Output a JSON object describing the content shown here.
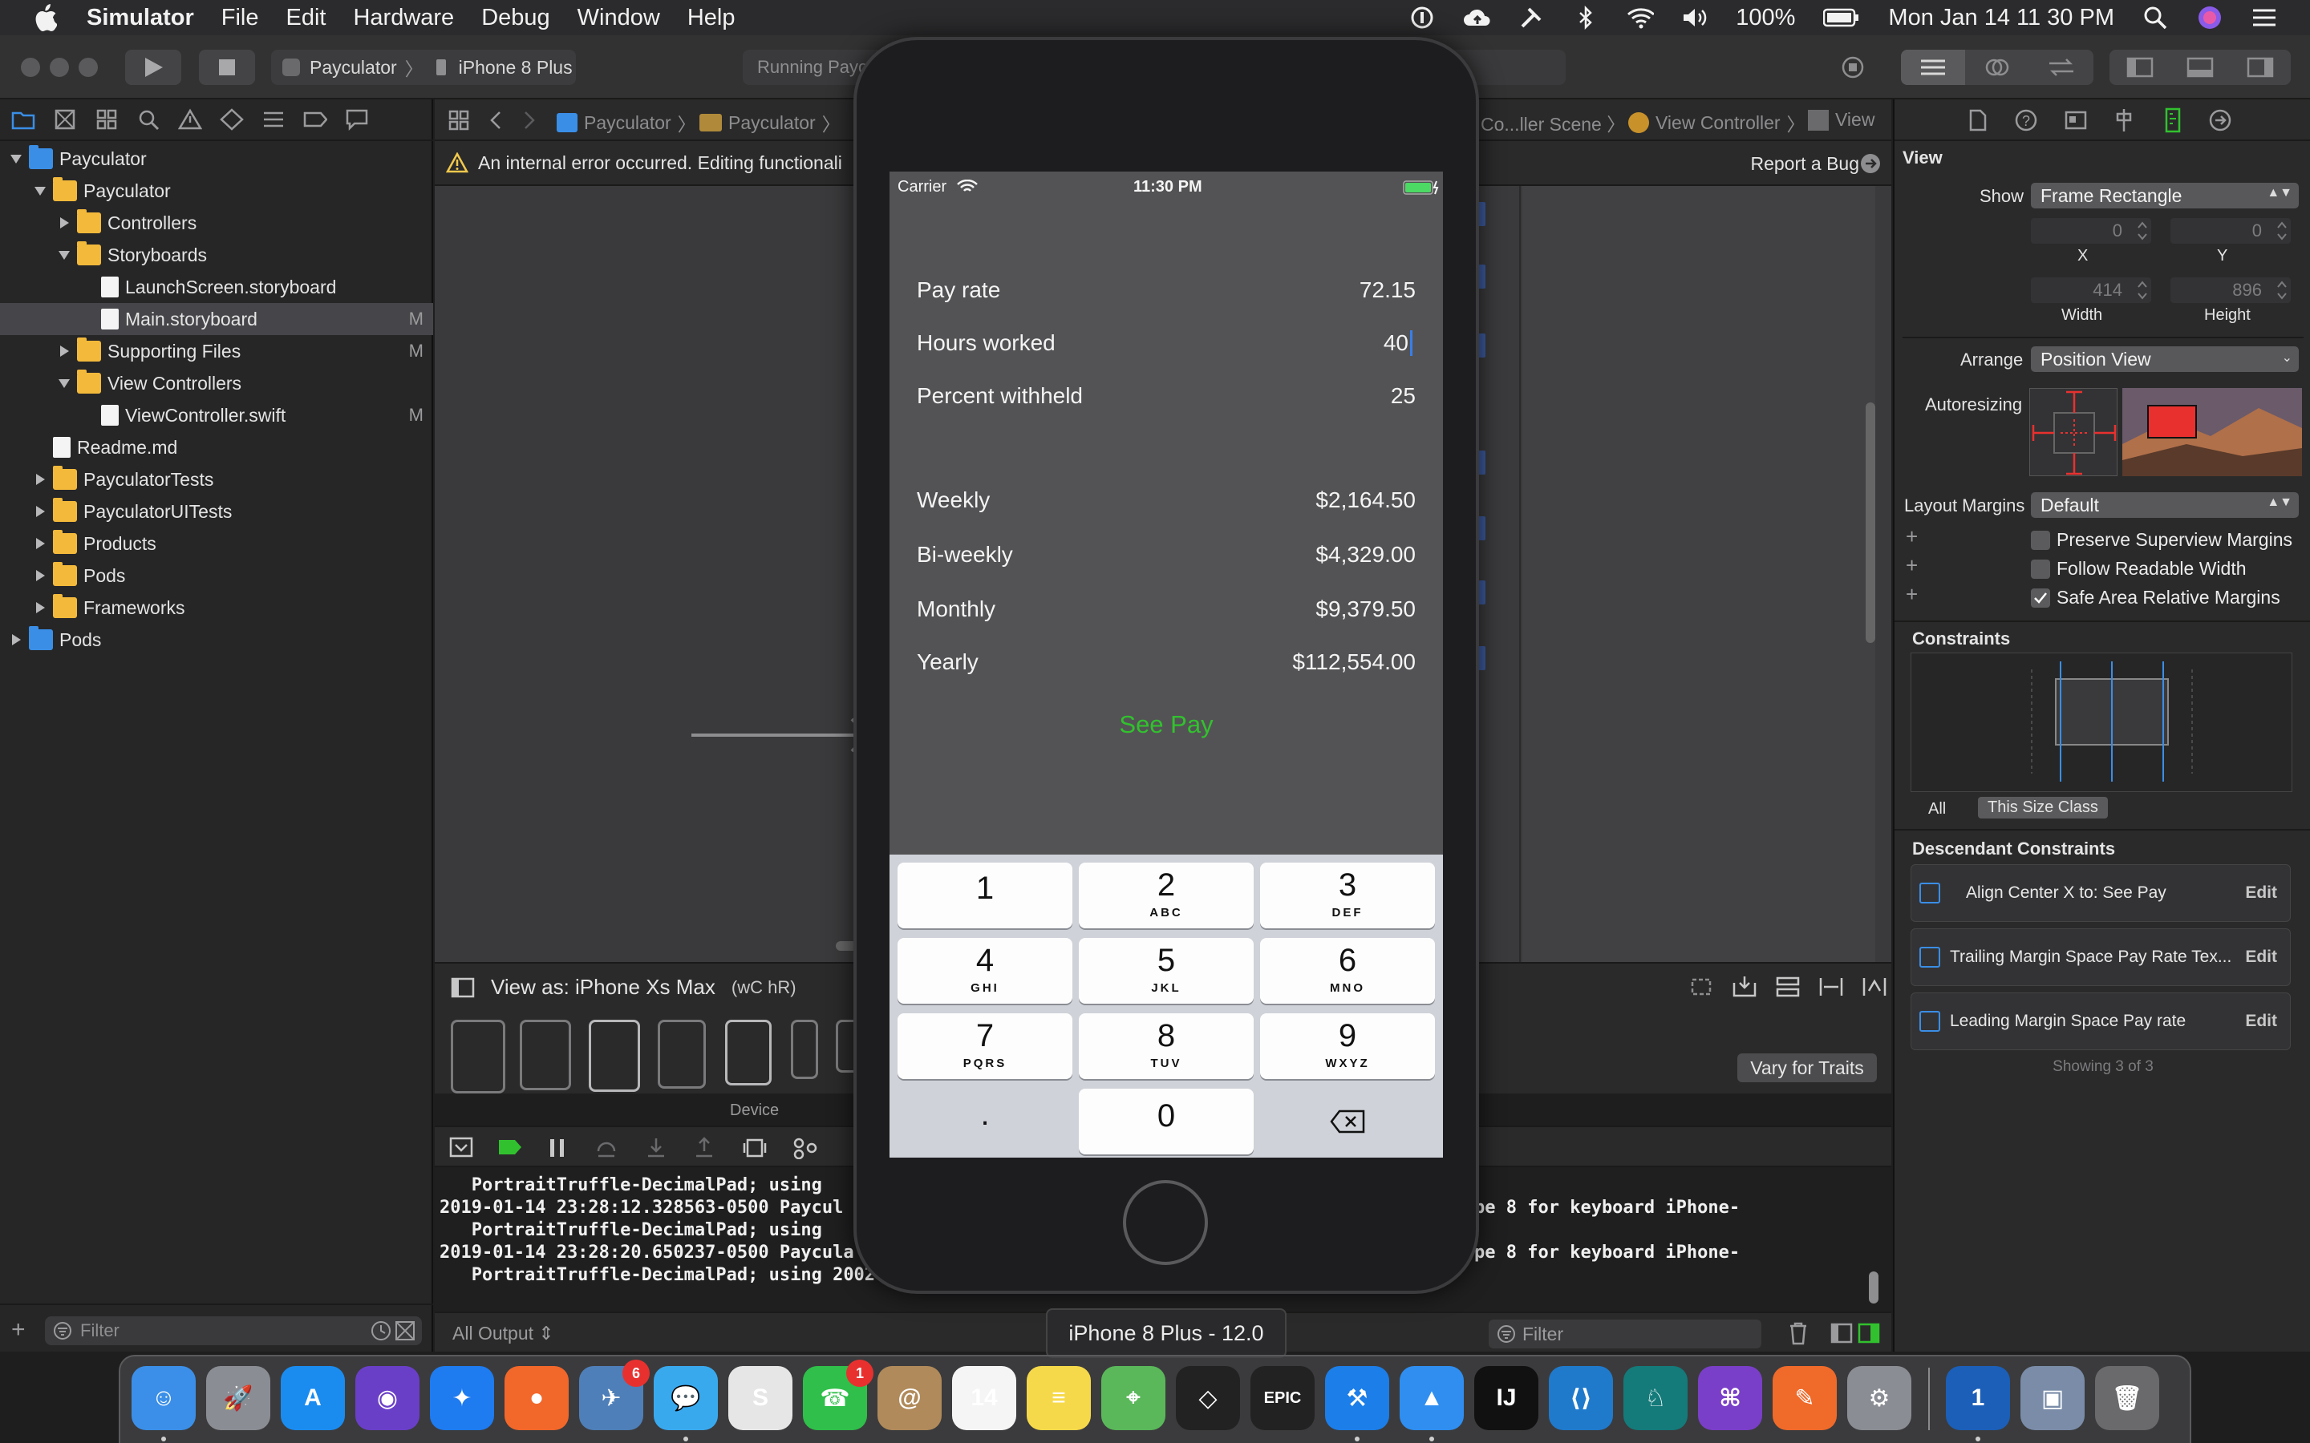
{
  "menubar": {
    "app_name": "Simulator",
    "items": [
      "File",
      "Edit",
      "Hardware",
      "Debug",
      "Window",
      "Help"
    ],
    "battery": "100%",
    "clock": "Mon Jan 14  11 30 PM"
  },
  "toolbar": {
    "scheme_name": "Payculator",
    "destination": "iPhone 8 Plus",
    "activity_text": "Running Payc"
  },
  "navigator": {
    "filter_placeholder": "Filter",
    "tree": [
      {
        "label": "Payculator",
        "type": "project",
        "depth": 0,
        "expanded": true
      },
      {
        "label": "Payculator",
        "type": "folder",
        "depth": 1,
        "expanded": true
      },
      {
        "label": "Controllers",
        "type": "folder",
        "depth": 2,
        "expanded": false
      },
      {
        "label": "Storyboards",
        "type": "folder",
        "depth": 2,
        "expanded": true
      },
      {
        "label": "LaunchScreen.storyboard",
        "type": "file",
        "depth": 3
      },
      {
        "label": "Main.storyboard",
        "type": "file",
        "depth": 3,
        "badge": "M",
        "selected": true
      },
      {
        "label": "Supporting Files",
        "type": "folder",
        "depth": 2,
        "expanded": false,
        "badge": "M"
      },
      {
        "label": "View Controllers",
        "type": "folder",
        "depth": 2,
        "expanded": true
      },
      {
        "label": "ViewController.swift",
        "type": "file",
        "depth": 3,
        "badge": "M"
      },
      {
        "label": "Readme.md",
        "type": "file",
        "depth": 1
      },
      {
        "label": "PayculatorTests",
        "type": "folder",
        "depth": 1,
        "expanded": false
      },
      {
        "label": "PayculatorUITests",
        "type": "folder",
        "depth": 1,
        "expanded": false
      },
      {
        "label": "Products",
        "type": "folder",
        "depth": 1,
        "expanded": false
      },
      {
        "label": "Pods",
        "type": "folder",
        "depth": 1,
        "expanded": false
      },
      {
        "label": "Frameworks",
        "type": "folder",
        "depth": 1,
        "expanded": false
      },
      {
        "label": "Pods",
        "type": "project",
        "depth": 0,
        "expanded": false
      }
    ]
  },
  "editor": {
    "jumpbar": [
      "Payculator",
      "Payculator",
      "Co...ller Scene",
      "View Controller",
      "View"
    ],
    "warning": "An internal error occurred. Editing functionali",
    "report_bug": "Report a Bug",
    "view_as": "View as: iPhone Xs Max",
    "size_class_w": "wC",
    "size_class_h": "hR",
    "device_label": "Device",
    "vary_for_traits": "Vary for Traits"
  },
  "console": {
    "lines": [
      "   PortraitTruffle-DecimalPad; using",
      "2019-01-14 23:28:12.328563-0500 Paycul",
      "   PortraitTruffle-DecimalPad; using",
      "2019-01-14 23:28:20.650237-0500 Paycula",
      "   PortraitTruffle-DecimalPad; using 2002"
    ],
    "lines_right": [
      "pe 8 for keyboard iPhone-",
      "pe 8 for keyboard iPhone-"
    ],
    "output_selector": "All Output",
    "filter_placeholder": "Filter"
  },
  "inspector": {
    "section_title": "View",
    "show_label": "Show",
    "show_value": "Frame Rectangle",
    "x_value": "0",
    "y_value": "0",
    "x_label": "X",
    "y_label": "Y",
    "width_value": "414",
    "height_value": "896",
    "width_label": "Width",
    "height_label": "Height",
    "arrange_label": "Arrange",
    "arrange_value": "Position View",
    "autoresizing_label": "Autoresizing",
    "layout_margins_label": "Layout Margins",
    "layout_margins_value": "Default",
    "checkboxes": [
      {
        "label": "Preserve Superview Margins",
        "checked": false
      },
      {
        "label": "Follow Readable Width",
        "checked": false
      },
      {
        "label": "Safe Area Relative Margins",
        "checked": true
      }
    ],
    "constraints_title": "Constraints",
    "tab_all": "All",
    "tab_size_class": "This Size Class",
    "descendant_title": "Descendant Constraints",
    "constraints": [
      {
        "label": "Align Center X to:  See Pay",
        "action": "Edit"
      },
      {
        "label": "Trailing Margin Space  Pay Rate Tex...",
        "action": "Edit"
      },
      {
        "label": "Leading Margin Space Pay rate",
        "action": "Edit"
      }
    ],
    "showing": "Showing 3 of 3"
  },
  "simulator": {
    "carrier": "Carrier",
    "time": "11:30 PM",
    "inputs": [
      {
        "label": "Pay rate",
        "value": "72.15"
      },
      {
        "label": "Hours worked",
        "value": "40"
      },
      {
        "label": "Percent withheld",
        "value": "25"
      }
    ],
    "results": [
      {
        "label": "Weekly",
        "value": "$2,164.50"
      },
      {
        "label": "Bi-weekly",
        "value": "$4,329.00"
      },
      {
        "label": "Monthly",
        "value": "$9,379.50"
      },
      {
        "label": "Yearly",
        "value": "$112,554.00"
      }
    ],
    "see_pay": "See Pay",
    "keys": [
      {
        "num": "1",
        "letters": ""
      },
      {
        "num": "2",
        "letters": "ABC"
      },
      {
        "num": "3",
        "letters": "DEF"
      },
      {
        "num": "4",
        "letters": "GHI"
      },
      {
        "num": "5",
        "letters": "JKL"
      },
      {
        "num": "6",
        "letters": "MNO"
      },
      {
        "num": "7",
        "letters": "PQRS"
      },
      {
        "num": "8",
        "letters": "TUV"
      },
      {
        "num": "9",
        "letters": "WXYZ"
      },
      {
        "num": ".",
        "letters": ""
      },
      {
        "num": "0",
        "letters": ""
      }
    ],
    "device_name": "iPhone 8 Plus - 12.0"
  },
  "dock": {
    "apps": [
      {
        "name": "Finder",
        "color": "#3b8fe8",
        "glyph": "☺"
      },
      {
        "name": "Launchpad",
        "color": "#8a8d93",
        "glyph": "🚀"
      },
      {
        "name": "App Store",
        "color": "#1a8cf0",
        "glyph": "A"
      },
      {
        "name": "Siri",
        "color": "#6a3fc8",
        "glyph": "◉"
      },
      {
        "name": "Safari",
        "color": "#1e7bf0",
        "glyph": "✦"
      },
      {
        "name": "Firefox",
        "color": "#f2672a",
        "glyph": "●"
      },
      {
        "name": "Mail bird",
        "color": "#4f7fb8",
        "glyph": "✈",
        "badge": "6"
      },
      {
        "name": "Messages",
        "color": "#39a9ee",
        "glyph": "💬"
      },
      {
        "name": "Scrivener",
        "color": "#e6e6e6",
        "glyph": "S"
      },
      {
        "name": "FaceTime",
        "color": "#2fbf4a",
        "glyph": "☎",
        "badge": "1"
      },
      {
        "name": "Contacts",
        "color": "#b08a5a",
        "glyph": "@"
      },
      {
        "name": "Calendar",
        "color": "#f5f5f5",
        "glyph": "14"
      },
      {
        "name": "Notes",
        "color": "#f6d94a",
        "glyph": "≡"
      },
      {
        "name": "Maps",
        "color": "#5ab85a",
        "glyph": "⌖"
      },
      {
        "name": "Unity",
        "color": "#222222",
        "glyph": "◇"
      },
      {
        "name": "Epic Games",
        "color": "#222222",
        "glyph": "EPIC"
      },
      {
        "name": "Xcode",
        "color": "#1c7ee8",
        "glyph": "⚒"
      },
      {
        "name": "Simulator",
        "color": "#2f8ef0",
        "glyph": "▲"
      },
      {
        "name": "IntelliJ",
        "color": "#111111",
        "glyph": "IJ"
      },
      {
        "name": "VS Code",
        "color": "#1f7acc",
        "glyph": "⟨⟩"
      },
      {
        "name": "GitKraken",
        "color": "#147a7a",
        "glyph": "♘"
      },
      {
        "name": "GitHub",
        "color": "#7a3fc8",
        "glyph": "⌘"
      },
      {
        "name": "Sketch tool",
        "color": "#f06a2a",
        "glyph": "✎"
      },
      {
        "name": "System Preferences",
        "color": "#8a8d93",
        "glyph": "⚙"
      },
      {
        "name": "1Password",
        "color": "#1b5fb8",
        "glyph": "1"
      },
      {
        "name": "Preview",
        "color": "#7a8ca8",
        "glyph": "▣"
      },
      {
        "name": "Trash",
        "color": "#6a6a6c",
        "glyph": "🗑"
      }
    ]
  },
  "colors": {
    "accent_green": "#32c12e",
    "selection_blue": "#3a8ee6",
    "folder_yellow": "#f3b93a"
  }
}
